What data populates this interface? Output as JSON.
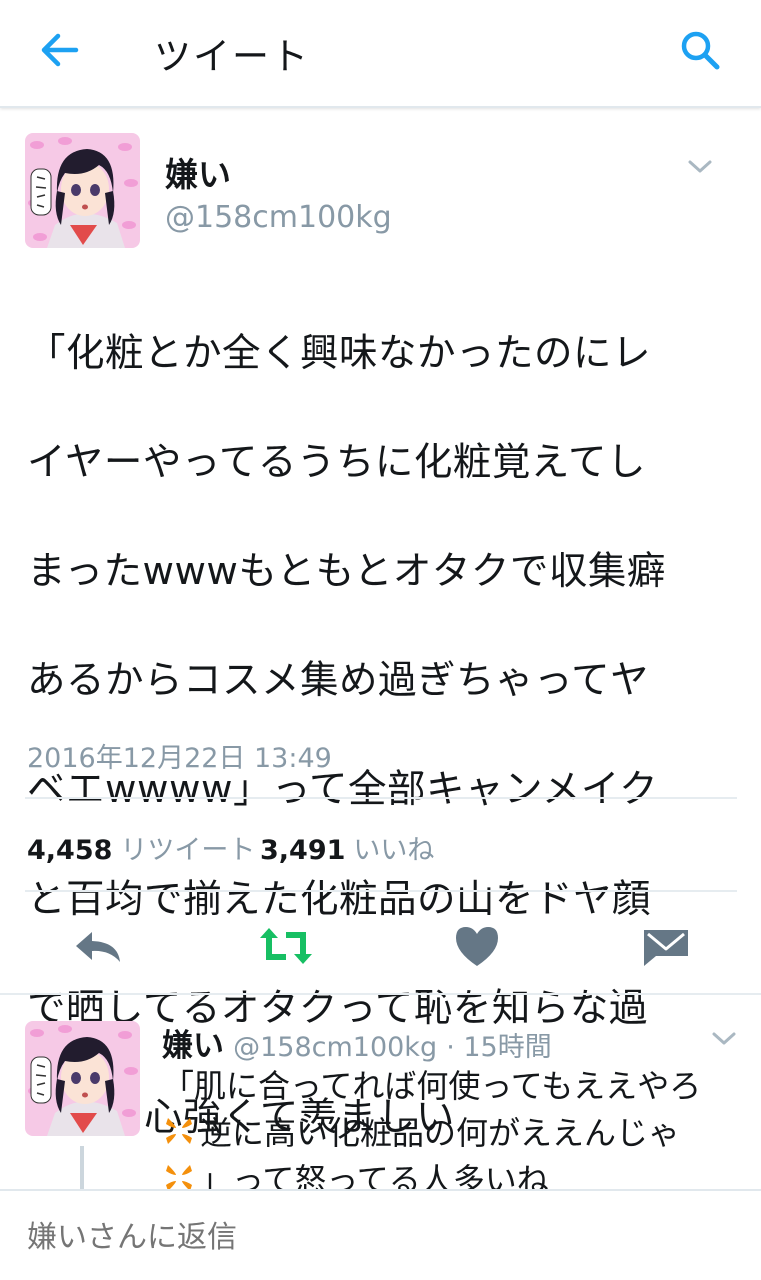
{
  "header": {
    "title": "ツイート",
    "back_icon": "arrow-left-icon",
    "search_icon": "search-icon",
    "accent": "#1da1f2"
  },
  "tweet": {
    "name": "嫌い",
    "handle": "@158cm100kg",
    "text": "「化粧とか全く興味なかったのにレイヤーやってるうちに化粧覚えてしまったwwwもともとオタクで収集癖あるからコスメ集め過ぎちゃってヤベエwwww」って全部キャンメイクと百均で揃えた化粧品の山をドヤ顔で晒してるオタクって恥を知らな過ぎてて心強くて羨ましい",
    "text_lines": [
      "「化粧とか全く興味なかったのにレ",
      "イヤーやってるうちに化粧覚えてし",
      "まったwwwもともとオタクで収集癖",
      "あるからコスメ集め過ぎちゃってヤ",
      "ベエwwww」って全部キャンメイク",
      "と百均で揃えた化粧品の山をドヤ顔",
      "で晒してるオタクって恥を知らな過",
      "ぎてて心強くて羨ましい"
    ],
    "timestamp": "2016年12月22日 13:49",
    "retweets": "4,458",
    "retweets_label": "リツイート",
    "likes": "3,491",
    "likes_label": "いいね",
    "actions": [
      "reply-icon",
      "retweet-icon",
      "heart-icon",
      "envelope-icon"
    ],
    "retweet_color": "#17bf63",
    "action_color": "#657786"
  },
  "reply": {
    "name": "嫌い",
    "handle": "@158cm100kg",
    "time": "· 15時間",
    "line1": "「肌に合ってれば何使ってもええやろ",
    "line2": "逆に高い化粧品の何がええんじゃ",
    "line3": "」って怒ってる人多いね",
    "emoji_icon": "anger-symbol-icon",
    "emoji_color": "#f4900c"
  },
  "composer": {
    "placeholder": "嫌いさんに返信"
  }
}
